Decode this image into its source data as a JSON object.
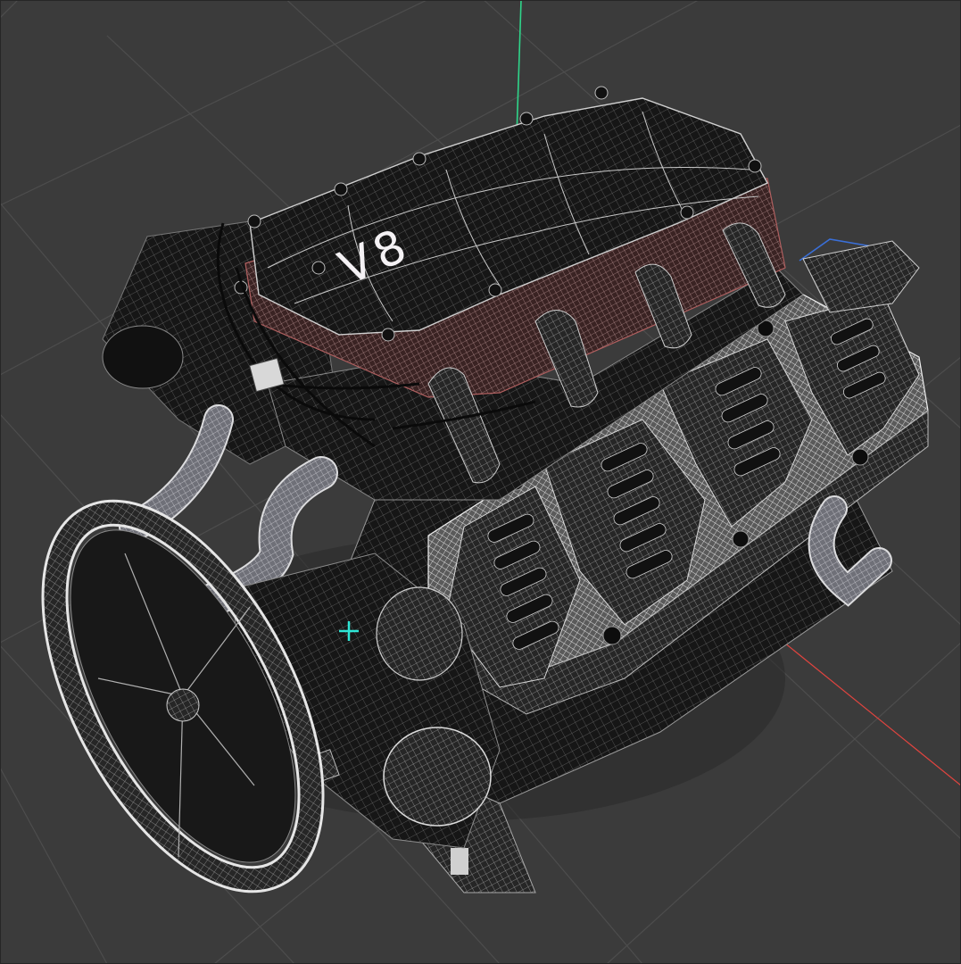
{
  "viewport": {
    "background": "#3b3b3b",
    "grid_color": "#4d4d4d",
    "axis_y_color": "#2fd58a",
    "axis_x_color": "#e0443f",
    "axis_z_color": "#3a6fd8",
    "pivot_color": "#2ee6d6",
    "pivot_icon": "crosshair-plus-icon"
  },
  "model": {
    "name": "v8-engine-wireframe",
    "engraving": "V8",
    "shading": "wireframe-on-shaded",
    "wire_color": "#d9d9d9",
    "body_color": "#1c1c1c",
    "accent_wire_color": "#a04a3f"
  }
}
